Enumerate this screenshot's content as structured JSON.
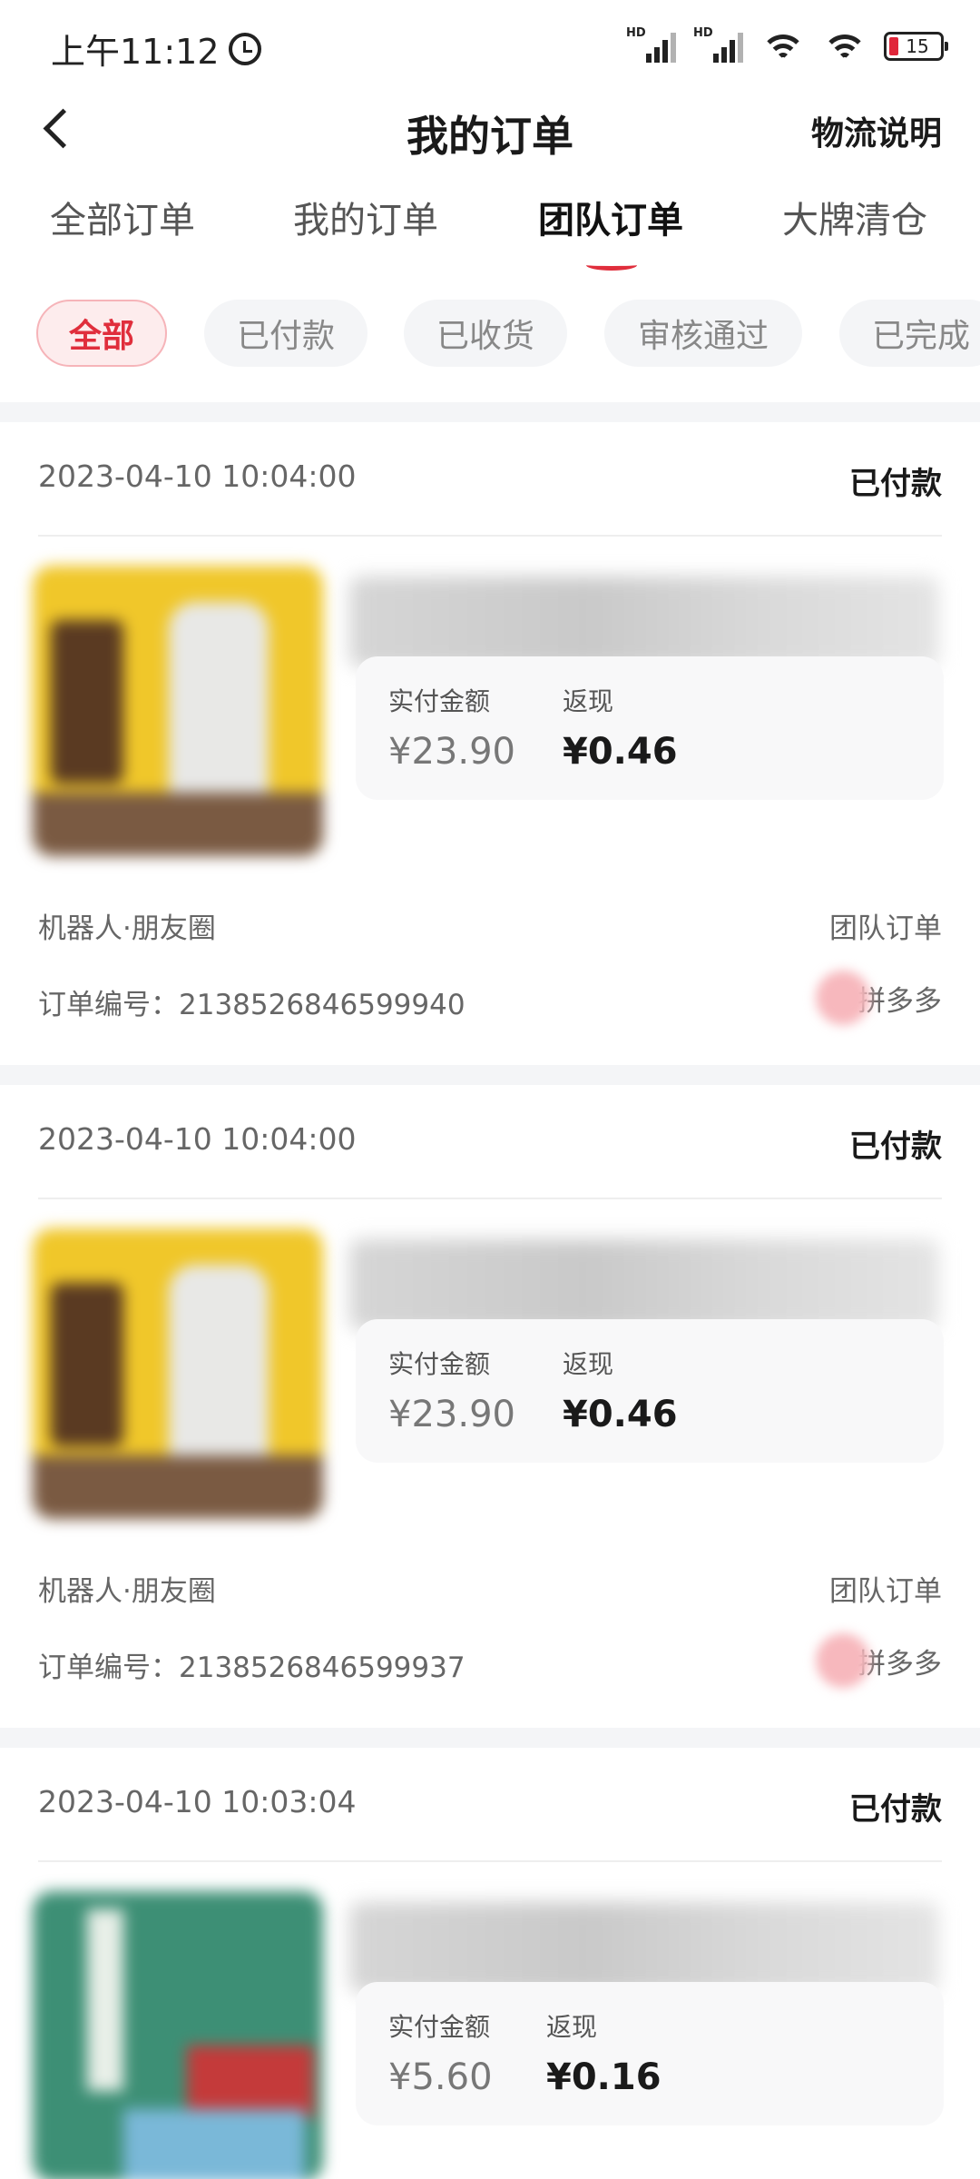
{
  "status_bar": {
    "time": "上午11:12",
    "signal_label": "HD",
    "battery": "15"
  },
  "nav": {
    "title": "我的订单",
    "right_action": "物流说明"
  },
  "tabs": [
    {
      "label": "全部订单",
      "active": false
    },
    {
      "label": "我的订单",
      "active": false
    },
    {
      "label": "团队订单",
      "active": true
    },
    {
      "label": "大牌清仓",
      "active": false
    }
  ],
  "filters": [
    {
      "label": "全部",
      "active": true
    },
    {
      "label": "已付款",
      "active": false
    },
    {
      "label": "已收货",
      "active": false
    },
    {
      "label": "审核通过",
      "active": false
    },
    {
      "label": "已完成",
      "active": false
    }
  ],
  "labels": {
    "paid_amount": "实付金额",
    "cashback": "返现",
    "order_no_prefix": "订单编号："
  },
  "orders": [
    {
      "date": "2023-04-10 10:04:00",
      "status": "已付款",
      "paid": "¥23.90",
      "cashback": "¥0.46",
      "source": "机器人·朋友圈",
      "type": "团队订单",
      "order_no": "订单编号：2138526846599940",
      "platform": "拼多多"
    },
    {
      "date": "2023-04-10 10:04:00",
      "status": "已付款",
      "paid": "¥23.90",
      "cashback": "¥0.46",
      "source": "机器人·朋友圈",
      "type": "团队订单",
      "order_no": "订单编号：2138526846599937",
      "platform": "拼多多"
    },
    {
      "date": "2023-04-10 10:03:04",
      "status": "已付款",
      "paid": "¥5.60",
      "cashback": "¥0.16"
    }
  ],
  "colors": {
    "accent": "#e02e3c",
    "chip_bg": "#f4f5f7",
    "price_box_bg": "#f8f8f9"
  },
  "icons": [
    "alarm-icon",
    "signal-icon",
    "wifi-icon",
    "battery-icon",
    "back-icon"
  ]
}
